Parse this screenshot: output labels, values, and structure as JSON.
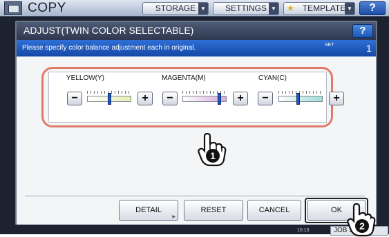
{
  "app": {
    "title": "COPY",
    "tabs": [
      {
        "label": "STORAGE"
      },
      {
        "label": "SETTINGS"
      },
      {
        "label": "TEMPLATE"
      }
    ],
    "help_label": "?"
  },
  "dialog": {
    "title": "ADJUST(TWIN COLOR SELECTABLE)",
    "help_label": "?",
    "info": "Please specify color balance adjustment each in original.",
    "set_label": "SET",
    "set_count": "1"
  },
  "channels": [
    {
      "label": "YELLOW(Y)",
      "level": 0.5,
      "color": "#e8eeb0",
      "minus": "−",
      "plus": "+"
    },
    {
      "label": "MAGENTA(M)",
      "level": 0.83,
      "color": "#d9a8d6",
      "minus": "−",
      "plus": "+"
    },
    {
      "label": "CYAN(C)",
      "level": 0.45,
      "color": "#9fdcd8",
      "minus": "−",
      "plus": "+"
    }
  ],
  "buttons": {
    "detail": "DETAIL",
    "reset": "RESET",
    "cancel": "CANCEL",
    "ok": "OK"
  },
  "status": {
    "time": "10:13",
    "jobs": "JOB S"
  },
  "callouts": {
    "step1": "1",
    "step2": "2"
  },
  "colors": {
    "highlight": "#e07a68",
    "info_bar": "#1f5cc4",
    "knob": "#1f58c8"
  }
}
